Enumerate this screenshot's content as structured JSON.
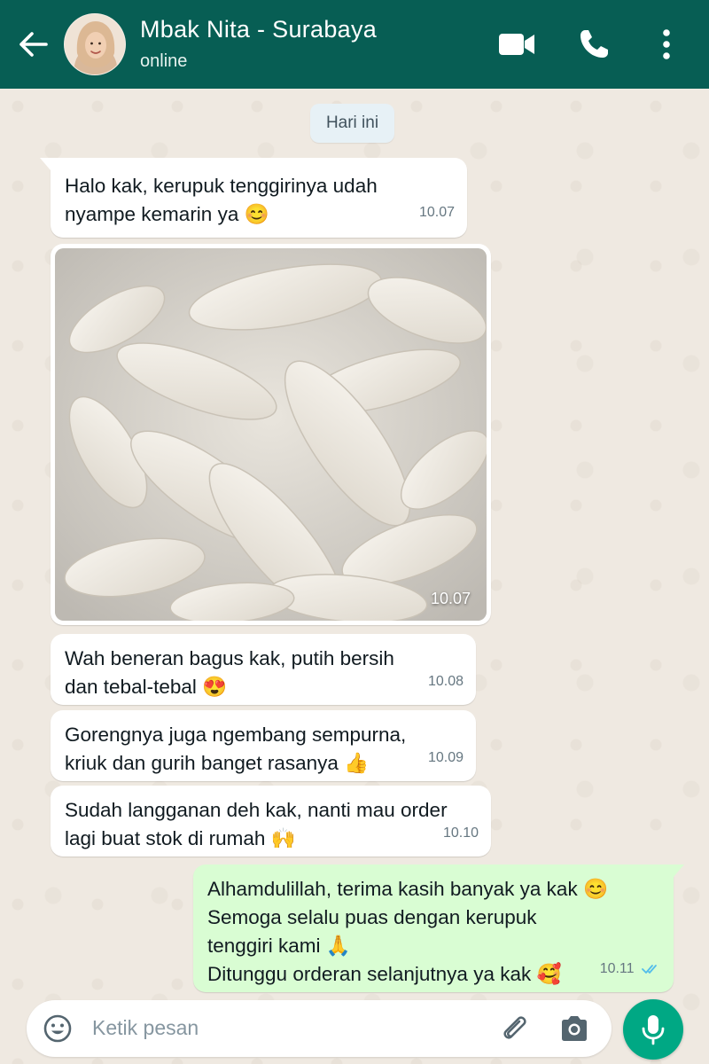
{
  "header": {
    "contact_name": "Mbak Nita - Surabaya",
    "status": "online",
    "accent_color": "#075e54"
  },
  "date_chip": "Hari ini",
  "messages": [
    {
      "direction": "incoming",
      "lines": [
        "Halo kak, kerupuk tenggirinya udah",
        "nyampe kemarin ya 😊"
      ],
      "time": "10.07"
    },
    {
      "direction": "incoming",
      "type": "image",
      "image_subject": "kerupuk tenggiri",
      "time": "10.07"
    },
    {
      "direction": "incoming",
      "lines": [
        "Wah beneran bagus kak, putih bersih",
        "dan tebal-tebal 😍"
      ],
      "time": "10.08"
    },
    {
      "direction": "incoming",
      "lines": [
        "Gorengnya juga ngembang sempurna,",
        "kriuk dan gurih banget rasanya 👍"
      ],
      "time": "10.09"
    },
    {
      "direction": "incoming",
      "lines": [
        "Sudah langganan deh kak, nanti mau order",
        "lagi buat stok di rumah 🙌"
      ],
      "time": "10.10"
    },
    {
      "direction": "outgoing",
      "lines": [
        "Alhamdulillah, terima kasih banyak ya kak 😊",
        "Semoga selalu puas dengan kerupuk",
        "tenggiri kami 🙏",
        "Ditunggu orderan selanjutnya ya kak 🥰"
      ],
      "time": "10.11",
      "read": true
    }
  ],
  "input": {
    "placeholder": "Ketik pesan"
  },
  "icons": {
    "back": "back-arrow-icon",
    "video": "video-call-icon",
    "phone": "phone-call-icon",
    "menu": "more-options-icon",
    "emoji": "emoji-icon",
    "attach": "attach-icon",
    "camera": "camera-icon",
    "mic": "microphone-icon"
  }
}
